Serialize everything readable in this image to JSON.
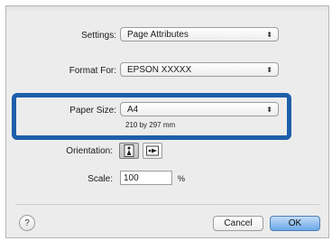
{
  "settings": {
    "label": "Settings:",
    "value": "Page Attributes"
  },
  "format_for": {
    "label": "Format For:",
    "value": "EPSON XXXXX"
  },
  "paper_size": {
    "label": "Paper Size:",
    "value": "A4",
    "dimensions": "210 by 297 mm"
  },
  "orientation": {
    "label": "Orientation:",
    "selected": "portrait"
  },
  "scale": {
    "label": "Scale:",
    "value": "100",
    "unit": "%"
  },
  "help": {
    "glyph": "?"
  },
  "buttons": {
    "cancel": "Cancel",
    "ok": "OK"
  },
  "colors": {
    "highlight": "#1d5fa9",
    "default_button": "#6aa7e8"
  }
}
